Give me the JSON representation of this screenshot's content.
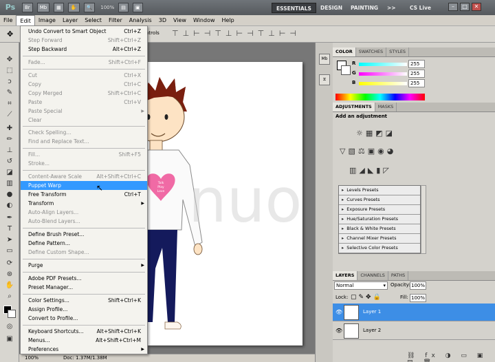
{
  "titlebar": {
    "app_icon": "Ps",
    "btn_br": "Br",
    "btn_mb": "Mb",
    "zoom": "100%",
    "workspaces": [
      "ESSENTIALS",
      "DESIGN",
      "PAINTING",
      ">>"
    ],
    "cs_live": "CS Live",
    "window_controls": [
      "–",
      "□",
      "✕"
    ]
  },
  "menubar": [
    "File",
    "Edit",
    "Image",
    "Layer",
    "Select",
    "Filter",
    "Analysis",
    "3D",
    "View",
    "Window",
    "Help"
  ],
  "options": {
    "controls_label": "ntrols"
  },
  "edit_menu": [
    {
      "label": "Undo Convert to Smart Object",
      "shortcut": "Ctrl+Z",
      "disabled": false
    },
    {
      "label": "Step Forward",
      "shortcut": "Shift+Ctrl+Z",
      "disabled": true
    },
    {
      "label": "Step Backward",
      "shortcut": "Alt+Ctrl+Z",
      "disabled": false
    },
    {
      "label": "Fade...",
      "shortcut": "Shift+Ctrl+F",
      "disabled": true
    },
    {
      "label": "Cut",
      "shortcut": "Ctrl+X",
      "disabled": true
    },
    {
      "label": "Copy",
      "shortcut": "Ctrl+C",
      "disabled": true
    },
    {
      "label": "Copy Merged",
      "shortcut": "Shift+Ctrl+C",
      "disabled": true
    },
    {
      "label": "Paste",
      "shortcut": "Ctrl+V",
      "disabled": true
    },
    {
      "label": "Paste Special",
      "shortcut": "",
      "disabled": true
    },
    {
      "label": "Clear",
      "shortcut": "",
      "disabled": true
    },
    {
      "label": "Check Spelling...",
      "shortcut": "",
      "disabled": true
    },
    {
      "label": "Find and Replace Text...",
      "shortcut": "",
      "disabled": true
    },
    {
      "label": "Fill...",
      "shortcut": "Shift+F5",
      "disabled": true
    },
    {
      "label": "Stroke...",
      "shortcut": "",
      "disabled": true
    },
    {
      "label": "Content-Aware Scale",
      "shortcut": "Alt+Shift+Ctrl+C",
      "disabled": true
    },
    {
      "label": "Puppet Warp",
      "shortcut": "",
      "disabled": false
    },
    {
      "label": "Free Transform",
      "shortcut": "Ctrl+T",
      "disabled": false
    },
    {
      "label": "Transform",
      "shortcut": "",
      "disabled": false
    },
    {
      "label": "Auto-Align Layers...",
      "shortcut": "",
      "disabled": true
    },
    {
      "label": "Auto-Blend Layers...",
      "shortcut": "",
      "disabled": true
    },
    {
      "label": "Define Brush Preset...",
      "shortcut": "",
      "disabled": false
    },
    {
      "label": "Define Pattern...",
      "shortcut": "",
      "disabled": false
    },
    {
      "label": "Define Custom Shape...",
      "shortcut": "",
      "disabled": true
    },
    {
      "label": "Purge",
      "shortcut": "",
      "disabled": false
    },
    {
      "label": "Adobe PDF Presets...",
      "shortcut": "",
      "disabled": false
    },
    {
      "label": "Preset Manager...",
      "shortcut": "",
      "disabled": false
    },
    {
      "label": "Color Settings...",
      "shortcut": "Shift+Ctrl+K",
      "disabled": false
    },
    {
      "label": "Assign Profile...",
      "shortcut": "",
      "disabled": false
    },
    {
      "label": "Convert to Profile...",
      "shortcut": "",
      "disabled": false
    },
    {
      "label": "Keyboard Shortcuts...",
      "shortcut": "Alt+Shift+Ctrl+K",
      "disabled": false
    },
    {
      "label": "Menus...",
      "shortcut": "Alt+Shift+Ctrl+M",
      "disabled": false
    },
    {
      "label": "Preferences",
      "shortcut": "",
      "disabled": false
    }
  ],
  "canvas": {
    "shirt_text": [
      "Talk",
      "Play",
      "Love"
    ],
    "watermark": "nuon"
  },
  "status": {
    "zoom": "100%",
    "doc": "Doc: 1.37M/1.38M"
  },
  "color_panel": {
    "tabs": [
      "COLOR",
      "SWATCHES",
      "STYLES"
    ],
    "channels": [
      {
        "label": "R",
        "value": "255",
        "color": "#ff0000"
      },
      {
        "label": "G",
        "value": "255",
        "color": "#00c000"
      },
      {
        "label": "B",
        "value": "255",
        "color": "#0000ff"
      }
    ]
  },
  "adjustments_panel": {
    "tabs": [
      "ADJUSTMENTS",
      "MASKS"
    ],
    "title": "Add an adjustment",
    "presets": [
      "Levels Presets",
      "Curves Presets",
      "Exposure Presets",
      "Hue/Saturation Presets",
      "Black & White Presets",
      "Channel Mixer Presets",
      "Selective Color Presets"
    ]
  },
  "layers_panel": {
    "tabs": [
      "LAYERS",
      "CHANNELS",
      "PATHS"
    ],
    "blend_mode": "Normal",
    "opacity_label": "Opacity:",
    "opacity": "100%",
    "lock_label": "Lock:",
    "fill_label": "Fill:",
    "fill": "100%",
    "layers": [
      "Layer 1",
      "Layer 2"
    ]
  }
}
